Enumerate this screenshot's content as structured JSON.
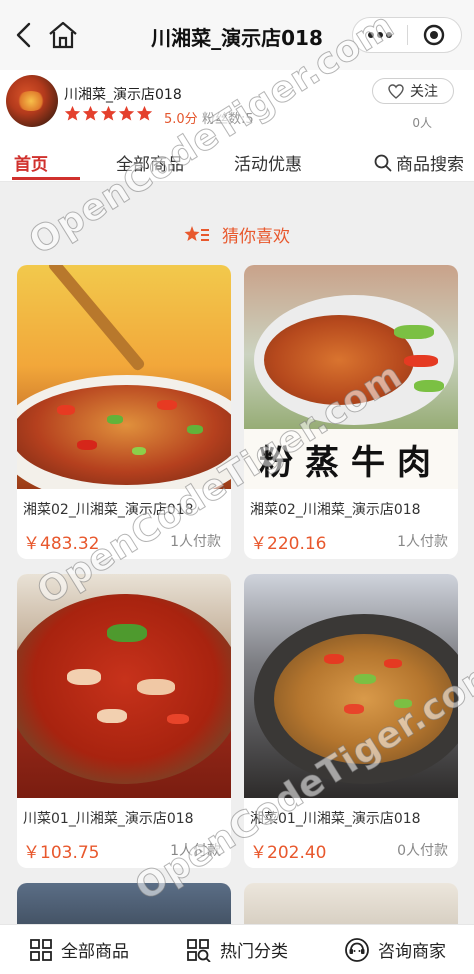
{
  "titlebar": {
    "title": "川湘菜_演示店018",
    "back_icon": "back-arrow-icon",
    "home_icon": "home-icon",
    "more_icon": "more-dots-icon",
    "close_icon": "target-close-icon"
  },
  "shop": {
    "name": "川湘菜_演示店018",
    "rating_stars": 5,
    "score": "5.0分",
    "fans_label": "粉丝数:5",
    "follow_label": "关注",
    "follow_count": "0人"
  },
  "tabs": [
    {
      "label": "首页",
      "active": true
    },
    {
      "label": "全部商品",
      "active": false
    },
    {
      "label": "活动优惠",
      "active": false
    },
    {
      "label": "商品搜索",
      "active": false
    }
  ],
  "section": {
    "title": "猜你喜欢"
  },
  "products": [
    {
      "name": "湘菜02_川湘菜_演示店018",
      "price": "￥483.32",
      "paid": "1人付款"
    },
    {
      "name": "湘菜02_川湘菜_演示店018",
      "price": "￥220.16",
      "paid": "1人付款",
      "image_text": "粉蒸牛肉"
    },
    {
      "name": "川菜01_川湘菜_演示店018",
      "price": "￥103.75",
      "paid": "1人付款"
    },
    {
      "name": "湘菜01_川湘菜_演示店018",
      "price": "￥202.40",
      "paid": "0人付款"
    }
  ],
  "bottom_bar": [
    {
      "label": "全部商品",
      "icon": "grid-icon"
    },
    {
      "label": "热门分类",
      "icon": "category-search-icon"
    },
    {
      "label": "咨询商家",
      "icon": "customer-service-icon"
    }
  ],
  "watermark": "OpenCodeTiger.com",
  "colors": {
    "accent": "#d0312d",
    "price": "#e8582d",
    "star": "#e4402d"
  }
}
